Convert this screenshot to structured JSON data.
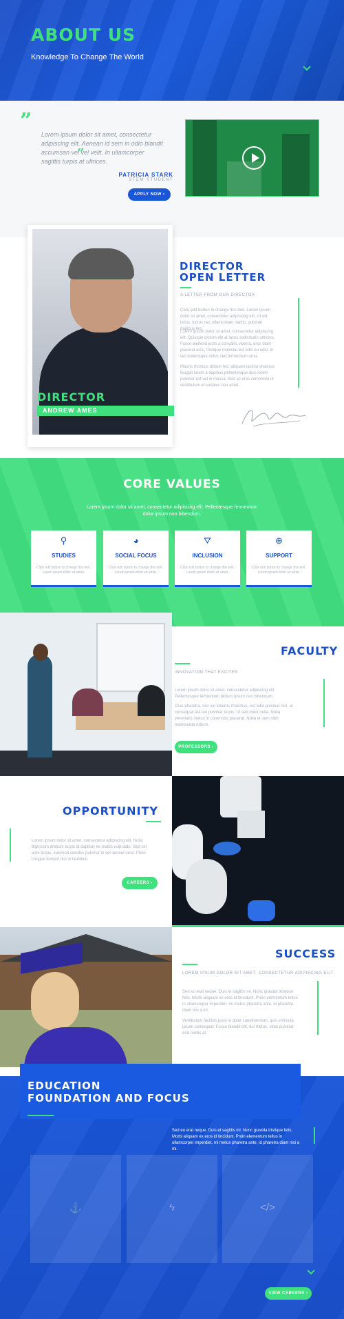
{
  "hero": {
    "title": "ABOUT US",
    "subtitle": "Knowledge To Change The World",
    "scroll_icon": "chevron-down-icon"
  },
  "testimonial": {
    "quote_icon": "quote-icon",
    "text": "Lorem ipsum dolor sit amet, consectetur adipiscing elit. Aenean id sem in odio blandit accumsan vel vel velit. In ullamcorper sagittis turpis at ultrices.",
    "name": "PATRICIA STARK",
    "role": "STEM STUDENT",
    "button": "APPLY NOW ›",
    "video_icon": "play-icon"
  },
  "director": {
    "photo_title": "DIRECTOR",
    "photo_name": "ANDREW AMES",
    "heading_line1": "DIRECTOR",
    "heading_line2": "OPEN LETTER",
    "kicker": "A LETTER FROM OUR DIRECTOR",
    "p1": "Click edit button to change this text. Lorem ipsum dolor sit amet, consectetur adipiscing elit. Ut elit tellus, luctus nec ullamcorper mattis, pulvinar dapibus leo.",
    "p2": "Lorem ipsum dolor sit amet, consectetur adipiscing elit. Quisque dictum elit at lacus sollicitudin ultricies. Fusce eleifend justo a convallis viverra, eros diam placerat arcu, tristique molestie est odio eu odio. In vel scelerisque dolor, sed fermentum urna.",
    "p3": "Mauris rhoncus dictum leo, aliquam lacinia vivamus feugiat lorem a dapibus pellentesque duis lorem pulvinar est vel in massa. Sed ac eros commodo ut vestibulum et sodales non amet."
  },
  "core_values": {
    "title": "CORE VALUES",
    "lead": "Lorem ipsum dolor sit amet, consectetur adipiscing elit. Pellentesque fermentum dolor ipsum non bibendum.",
    "cards": [
      {
        "icon": "pin-icon",
        "glyph": "⚲",
        "title": "STUDIES",
        "desc": "Click edit button to change this text. Lorem ipsum dolor sit amet."
      },
      {
        "icon": "globe-icon",
        "glyph": "◕",
        "title": "SOCIAL FOCUS",
        "desc": "Click edit button to change this text. Lorem ipsum dolor sit amet."
      },
      {
        "icon": "network-icon",
        "glyph": "⛛",
        "title": "INCLUSION",
        "desc": "Click edit button to change this text. Lorem ipsum dolor sit amet."
      },
      {
        "icon": "support-icon",
        "glyph": "⊕",
        "title": "SUPPORT",
        "desc": "Click edit button to change this text. Lorem ipsum dolor sit amet."
      }
    ]
  },
  "faculty": {
    "title": "FACULTY",
    "kicker": "INNOVATION THAT EXCITES",
    "p1": "Lorem ipsum dolor sit amet, consectetur adipiscing elit. Pellentesque fermentum dictum ipsum non bibendum.",
    "p2": "Cras pharetra, orci vel lobortis maximus, est odio pulvinar nisl, at consequat est leo pulvinar turpis. Ut sed dolor nulla. Nulla venenatis metus in commodo placerat. Nulla et sem nibh malesuada rutrum.",
    "button": "PROFESSORS ›"
  },
  "opportunity": {
    "title": "OPPORTUNITY",
    "p": "Lorem ipsum dolor sit amet, consectetur adipiscing elit. Nulla dignissim pretium turpis id dapibus ex mattis vulputate. Sed vel ante turpis, euismod sodales pulvinar in vel laoreet urna. Proin congue tempor nisi in faucibus.",
    "button": "CAREERS ›"
  },
  "success": {
    "title": "SUCCESS",
    "kicker": "LOREM IPSUM DOLOR SIT AMET, CONSECTETUR ADIPISCING ELIT.",
    "p1": "Sed eu erat neque. Duis et sagittis mi. Nunc gravida tristique felis. Morbi aliquam ex eros id tincidunt. Proin elementum tellus in ullamcorper imperdiet, mi metus pharetra ante, id pharetra diam nisi a mi.",
    "p2": "Vestibulum facilisis justo in dolor condimentum, quis vehicula ipsum consequat. Fusce blandit elit, dui metus, vitae pulvinar erat mollis at."
  },
  "education": {
    "title_line1": "EDUCATION",
    "title_line2": "FOUNDATION AND FOCUS",
    "p": "Sed eu erat neque. Duis et sagittis mi. Nunc gravida tristique felis. Morbi aliquam ex eros id tincidunt. Proin elementum tellus in ullamcorper imperdiet, mi metus pharetra ante, id pharetra diam nisi a mi.",
    "boxes": [
      {
        "icon": "anchor-icon",
        "glyph": "⚓"
      },
      {
        "icon": "bolt-icon",
        "glyph": "ϟ"
      },
      {
        "icon": "code-icon",
        "glyph": "</>"
      }
    ],
    "button": "VIEW CAREERS ›"
  }
}
